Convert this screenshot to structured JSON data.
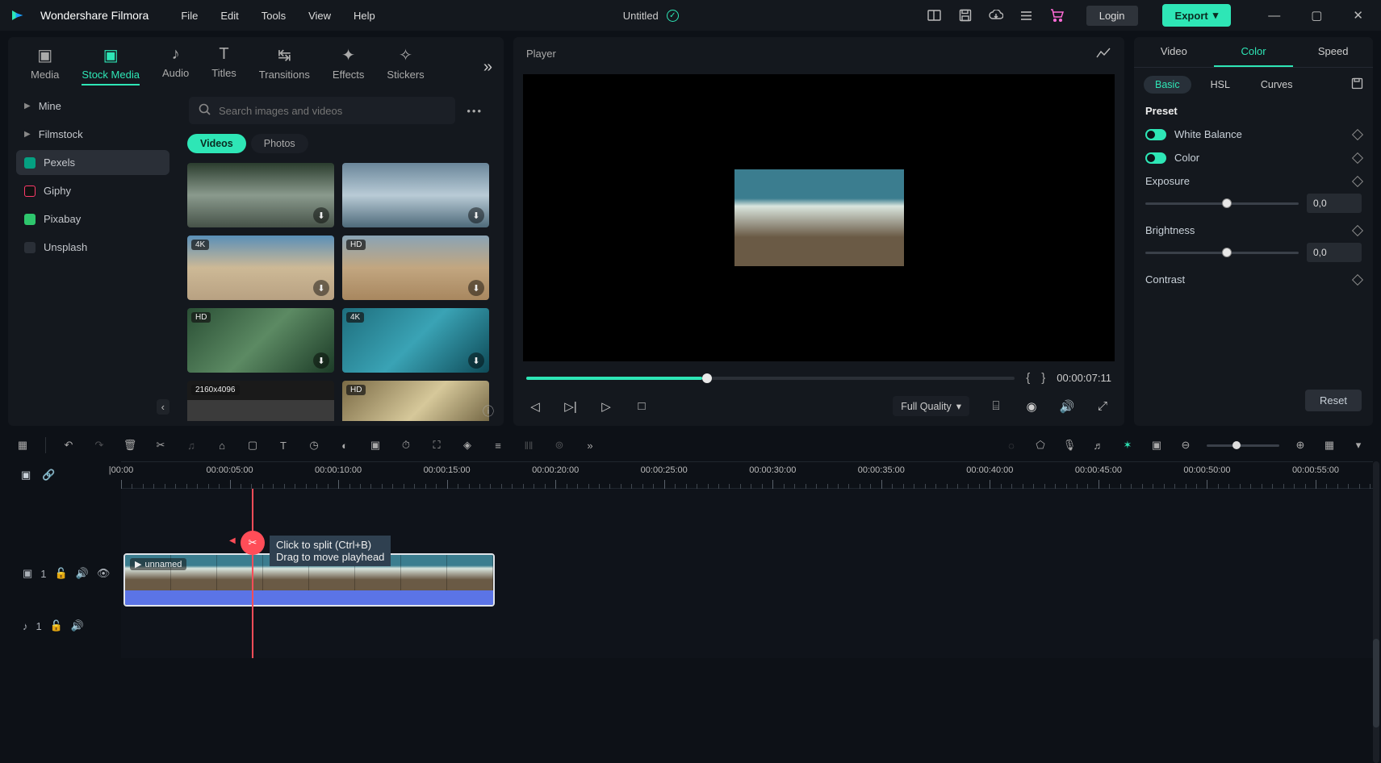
{
  "app": {
    "name": "Wondershare Filmora",
    "title": "Untitled"
  },
  "menu": [
    "File",
    "Edit",
    "Tools",
    "View",
    "Help"
  ],
  "topbar": {
    "login": "Login",
    "export": "Export"
  },
  "asset_tabs": [
    "Media",
    "Stock Media",
    "Audio",
    "Titles",
    "Transitions",
    "Effects",
    "Stickers"
  ],
  "asset_active": "Stock Media",
  "sources": [
    {
      "label": "Mine",
      "icon": "▶",
      "expandable": true
    },
    {
      "label": "Filmstock",
      "icon": "▶",
      "expandable": true
    },
    {
      "label": "Pexels",
      "icon": "px",
      "active": true,
      "color": "#05a081"
    },
    {
      "label": "Giphy",
      "icon": "g",
      "color": "#ff3b6b"
    },
    {
      "label": "Pixabay",
      "icon": "px",
      "color": "#2ec66d"
    },
    {
      "label": "Unsplash",
      "icon": "u",
      "color": "#e9e9e9"
    }
  ],
  "search": {
    "placeholder": "Search images and videos"
  },
  "filter": {
    "videos": "Videos",
    "photos": "Photos",
    "active": "Videos"
  },
  "thumbs": [
    {
      "badge": ""
    },
    {
      "badge": ""
    },
    {
      "badge": "4K"
    },
    {
      "badge": "HD"
    },
    {
      "badge": "HD"
    },
    {
      "badge": "4K"
    },
    {
      "badge": "2160x4096"
    },
    {
      "badge": "HD"
    }
  ],
  "player": {
    "label": "Player",
    "timecode": "00:00:07:11",
    "quality": "Full Quality"
  },
  "props": {
    "tabs": [
      "Video",
      "Color",
      "Speed"
    ],
    "active": "Color",
    "subtabs": [
      "Basic",
      "HSL",
      "Curves"
    ],
    "sub_active": "Basic",
    "preset": "Preset",
    "white_balance": "White Balance",
    "color": "Color",
    "exposure": {
      "label": "Exposure",
      "value": "0,0"
    },
    "brightness": {
      "label": "Brightness",
      "value": "0,0"
    },
    "contrast": {
      "label": "Contrast"
    },
    "reset": "Reset"
  },
  "ruler": [
    "|00:00",
    "00:00:05:00",
    "00:00:10:00",
    "00:00:15:00",
    "00:00:20:00",
    "00:00:25:00",
    "00:00:30:00",
    "00:00:35:00",
    "00:00:40:00",
    "00:00:45:00",
    "00:00:50:00",
    "00:00:55:00"
  ],
  "tooltip": {
    "l1": "Click to split (Ctrl+B)",
    "l2": "Drag to move playhead"
  },
  "clip": {
    "name": "unnamed"
  },
  "tracks": {
    "video": "1",
    "audio": "1"
  }
}
